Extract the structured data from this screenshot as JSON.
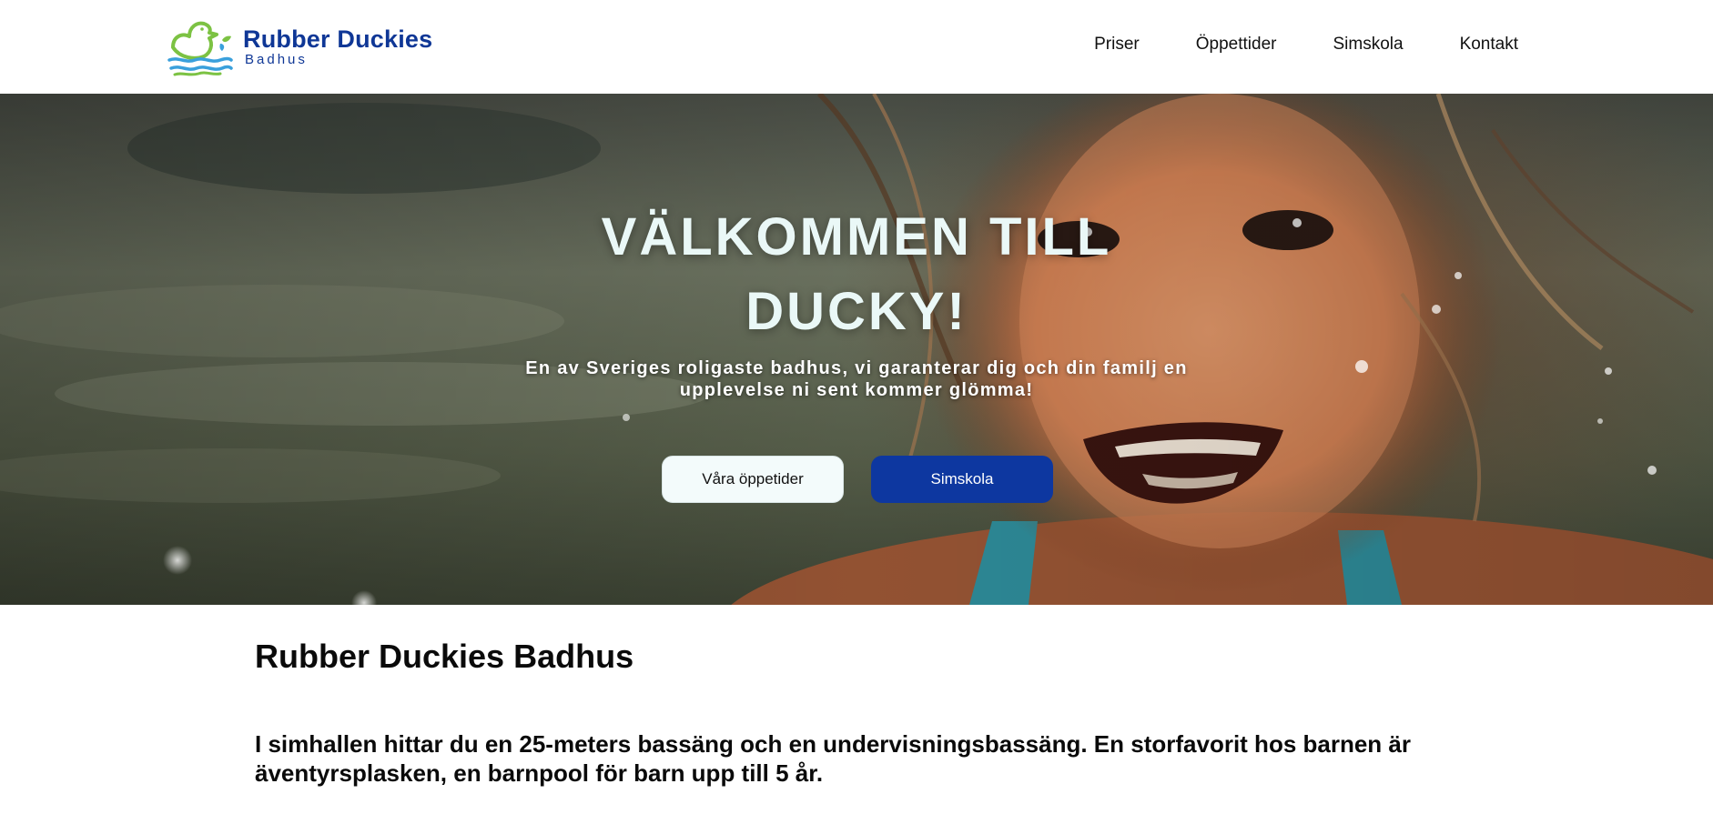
{
  "header": {
    "logo": {
      "name": "Rubber Duckies",
      "subtitle": "Badhus",
      "icon": "duck-waves-icon",
      "colors": {
        "text": "#0f3796",
        "duck": "#7cc243",
        "waves": "#3aa0dc"
      }
    },
    "nav": [
      {
        "label": "Priser"
      },
      {
        "label": "Öppettider"
      },
      {
        "label": "Simskola"
      },
      {
        "label": "Kontakt"
      }
    ]
  },
  "hero": {
    "title": "VÄLKOMMEN TILL DUCKY!",
    "subtitle": "En av Sveriges roligaste badhus, vi garanterar dig och din familj en upplevelse ni sent kommer glömma!",
    "buttons": {
      "opening_hours": "Våra öppetider",
      "swim_school": "Simskola"
    },
    "image": "smiling-child-splashing-in-water-photo"
  },
  "content": {
    "title": "Rubber Duckies Badhus",
    "intro": "I simhallen hittar du en 25-meters bassäng och en undervisningsbassäng. En storfavorit hos barnen är äventyrsplasken, en barnpool för barn upp till 5 år."
  },
  "colors": {
    "brand_blue": "#0d37a0",
    "hero_title": "#eaf8f7",
    "light_button": "#f3fbfb"
  }
}
